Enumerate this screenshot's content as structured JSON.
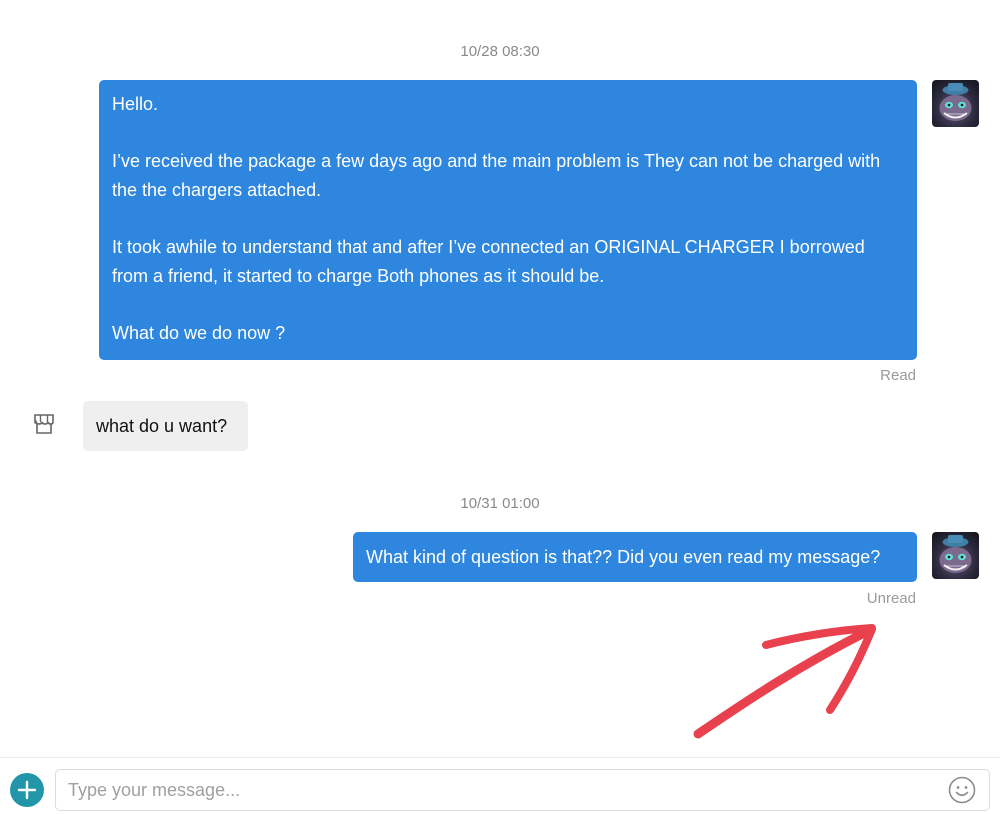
{
  "conversation": {
    "groups": [
      {
        "timestamp": "10/28 08:30",
        "outgoing": {
          "paragraphs": [
            "Hello.",
            "I’ve received the package a few days ago and the main problem is They can not be charged with the the chargers attached.",
            "It took awhile to understand that and after I’ve connected an ORIGINAL CHARGER I borrowed from a friend, it started to charge Both phones as it should be.",
            "What do we do now ?"
          ],
          "status": "Read"
        },
        "incoming": {
          "text": "what do u want?",
          "sender_icon": "store-icon"
        }
      },
      {
        "timestamp": "10/31 01:00",
        "outgoing": {
          "text": "What kind of question is that?? Did you even read my message?",
          "status": "Unread"
        }
      }
    ]
  },
  "composer": {
    "placeholder": "Type your message...",
    "attach_icon": "plus-icon",
    "emoji_icon": "smiley-icon"
  },
  "colors": {
    "outgoing_bubble": "#2e86de",
    "incoming_bubble": "#efefef",
    "attach_button": "#2196a8",
    "annotation_arrow": "#e8313f"
  }
}
